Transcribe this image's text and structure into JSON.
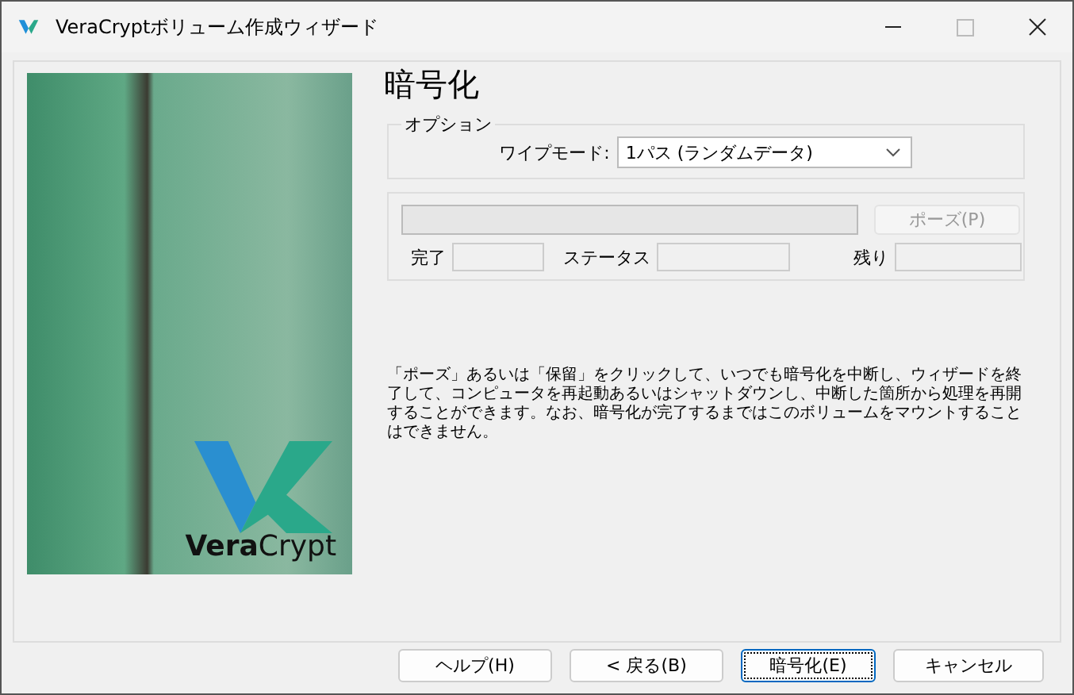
{
  "window": {
    "title": "VeraCryptボリューム作成ウィザード"
  },
  "banner": {
    "logo": "**Vera**Crypt"
  },
  "heading": "暗号化",
  "options": {
    "legend": "オプション",
    "wipe_label": "ワイプモード:",
    "wipe_value": "1パス (ランダムデータ)"
  },
  "progress": {
    "level": 0,
    "pause": {
      "label": "ポーズ(P)",
      "disabled": true
    },
    "fields": [
      {
        "label": "完了"
      },
      {
        "label": "ステータス"
      },
      {
        "label": "残り"
      }
    ]
  },
  "info": "「ポーズ」あるいは「保留」をクリックして、いつでも暗号化を中断し、ウィザードを終了して、コンピュータを再起動あるいはシャットダウンし、中断した箇所から処理を再開することができます。なお、暗号化が完了するまではこのボリュームをマウントすることはできません。",
  "buttons": [
    {
      "label": "ヘルプ(H)",
      "focused": false
    },
    {
      "label": "< 戻る(B)",
      "focused": false
    },
    {
      "label": "暗号化(E)",
      "focused": true
    },
    {
      "label": "キャンセル",
      "focused": false
    }
  ]
}
